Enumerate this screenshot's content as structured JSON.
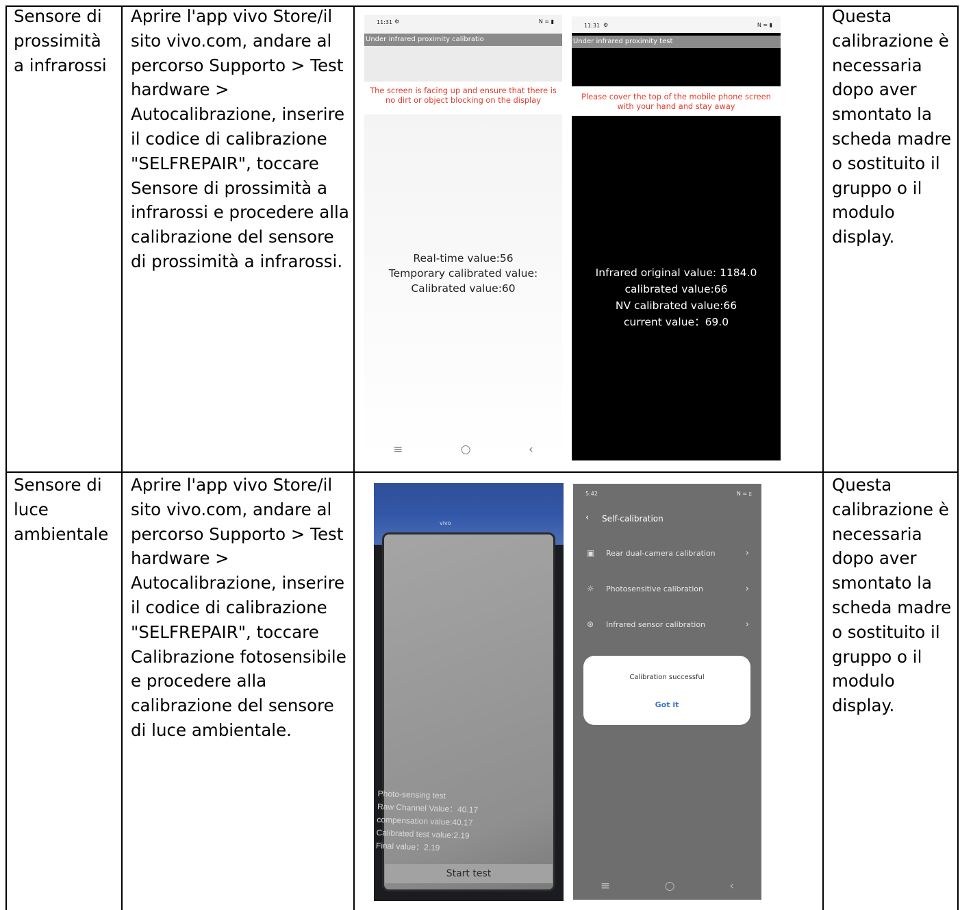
{
  "rows": [
    {
      "sensor": "Sensore di\nprossimità\na infrarossi",
      "procedure": "Aprire l'app vivo Store/il\nsito vivo.com, andare al\npercorso Supporto > Test\nhardware >\nAutocalibrazione, inserire\nil codice di calibrazione\n\"SELFREPAIR\", toccare\nSensore di prossimità a\ninfrarossi e procedere alla\ncalibrazione del sensore\ndi prossimità a infrarossi.",
      "note": "Questa\ncalibrazione è\nnecessaria\ndopo aver\nsmontato la\nscheda madre\no sostituito il\ngruppo o il\nmodulo\ndisplay."
    },
    {
      "sensor": "Sensore di\nluce\nambientale",
      "procedure": "Aprire l'app vivo Store/il\nsito vivo.com, andare al\npercorso Supporto > Test\nhardware >\nAutocalibrazione, inserire\nil codice di calibrazione\n\"SELFREPAIR\", toccare\nCalibrazione fotosensibile\ne procedere alla\ncalibrazione del sensore\ndi luce ambientale.",
      "note": "Questa\ncalibrazione è\nnecessaria\ndopo aver\nsmontato la\nscheda madre\no sostituito il\ngruppo o il\nmodulo\ndisplay."
    }
  ],
  "shot1": {
    "time": "11:31",
    "status_icons": "N ≈ ▮",
    "title": "Under infrared proximity calibratio",
    "instruction": "The screen is facing up and ensure that there is\nno dirt or object blocking on the display",
    "values": [
      "Real-time value:56",
      "Temporary calibrated value:",
      "Calibrated value:60"
    ],
    "nav": [
      "≡",
      "○",
      "‹"
    ]
  },
  "shot2": {
    "time": "11:31",
    "status_icons": "N ≈ ▮",
    "title": "Under infrared proximity test",
    "instruction": "Please cover the top of the mobile phone screen\nwith your hand and stay away",
    "values": [
      "Infrared original value: 1184.0",
      "calibrated value:66",
      "NV calibrated value:66",
      "current value：69.0"
    ]
  },
  "shot3": {
    "title": "Photo-sensing test",
    "lines": [
      "Raw Channel Value：40.17",
      "compensation value:40.17",
      "Calibrated test value:2.19",
      "Final value：2.19"
    ],
    "button": "Start test"
  },
  "shot4": {
    "time": "5:42",
    "status_icons": "N ≈ ▯",
    "header": "Self-calibration",
    "items": [
      {
        "icon": "camera-icon",
        "label": "Rear dual-camera calibration"
      },
      {
        "icon": "sun-icon",
        "label": "Photosensitive calibration"
      },
      {
        "icon": "infrared-icon",
        "label": "Infrared sensor calibration"
      }
    ],
    "dialog_text": "Calibration successful",
    "dialog_button": "Got it",
    "nav": [
      "≡",
      "○",
      "‹"
    ]
  }
}
